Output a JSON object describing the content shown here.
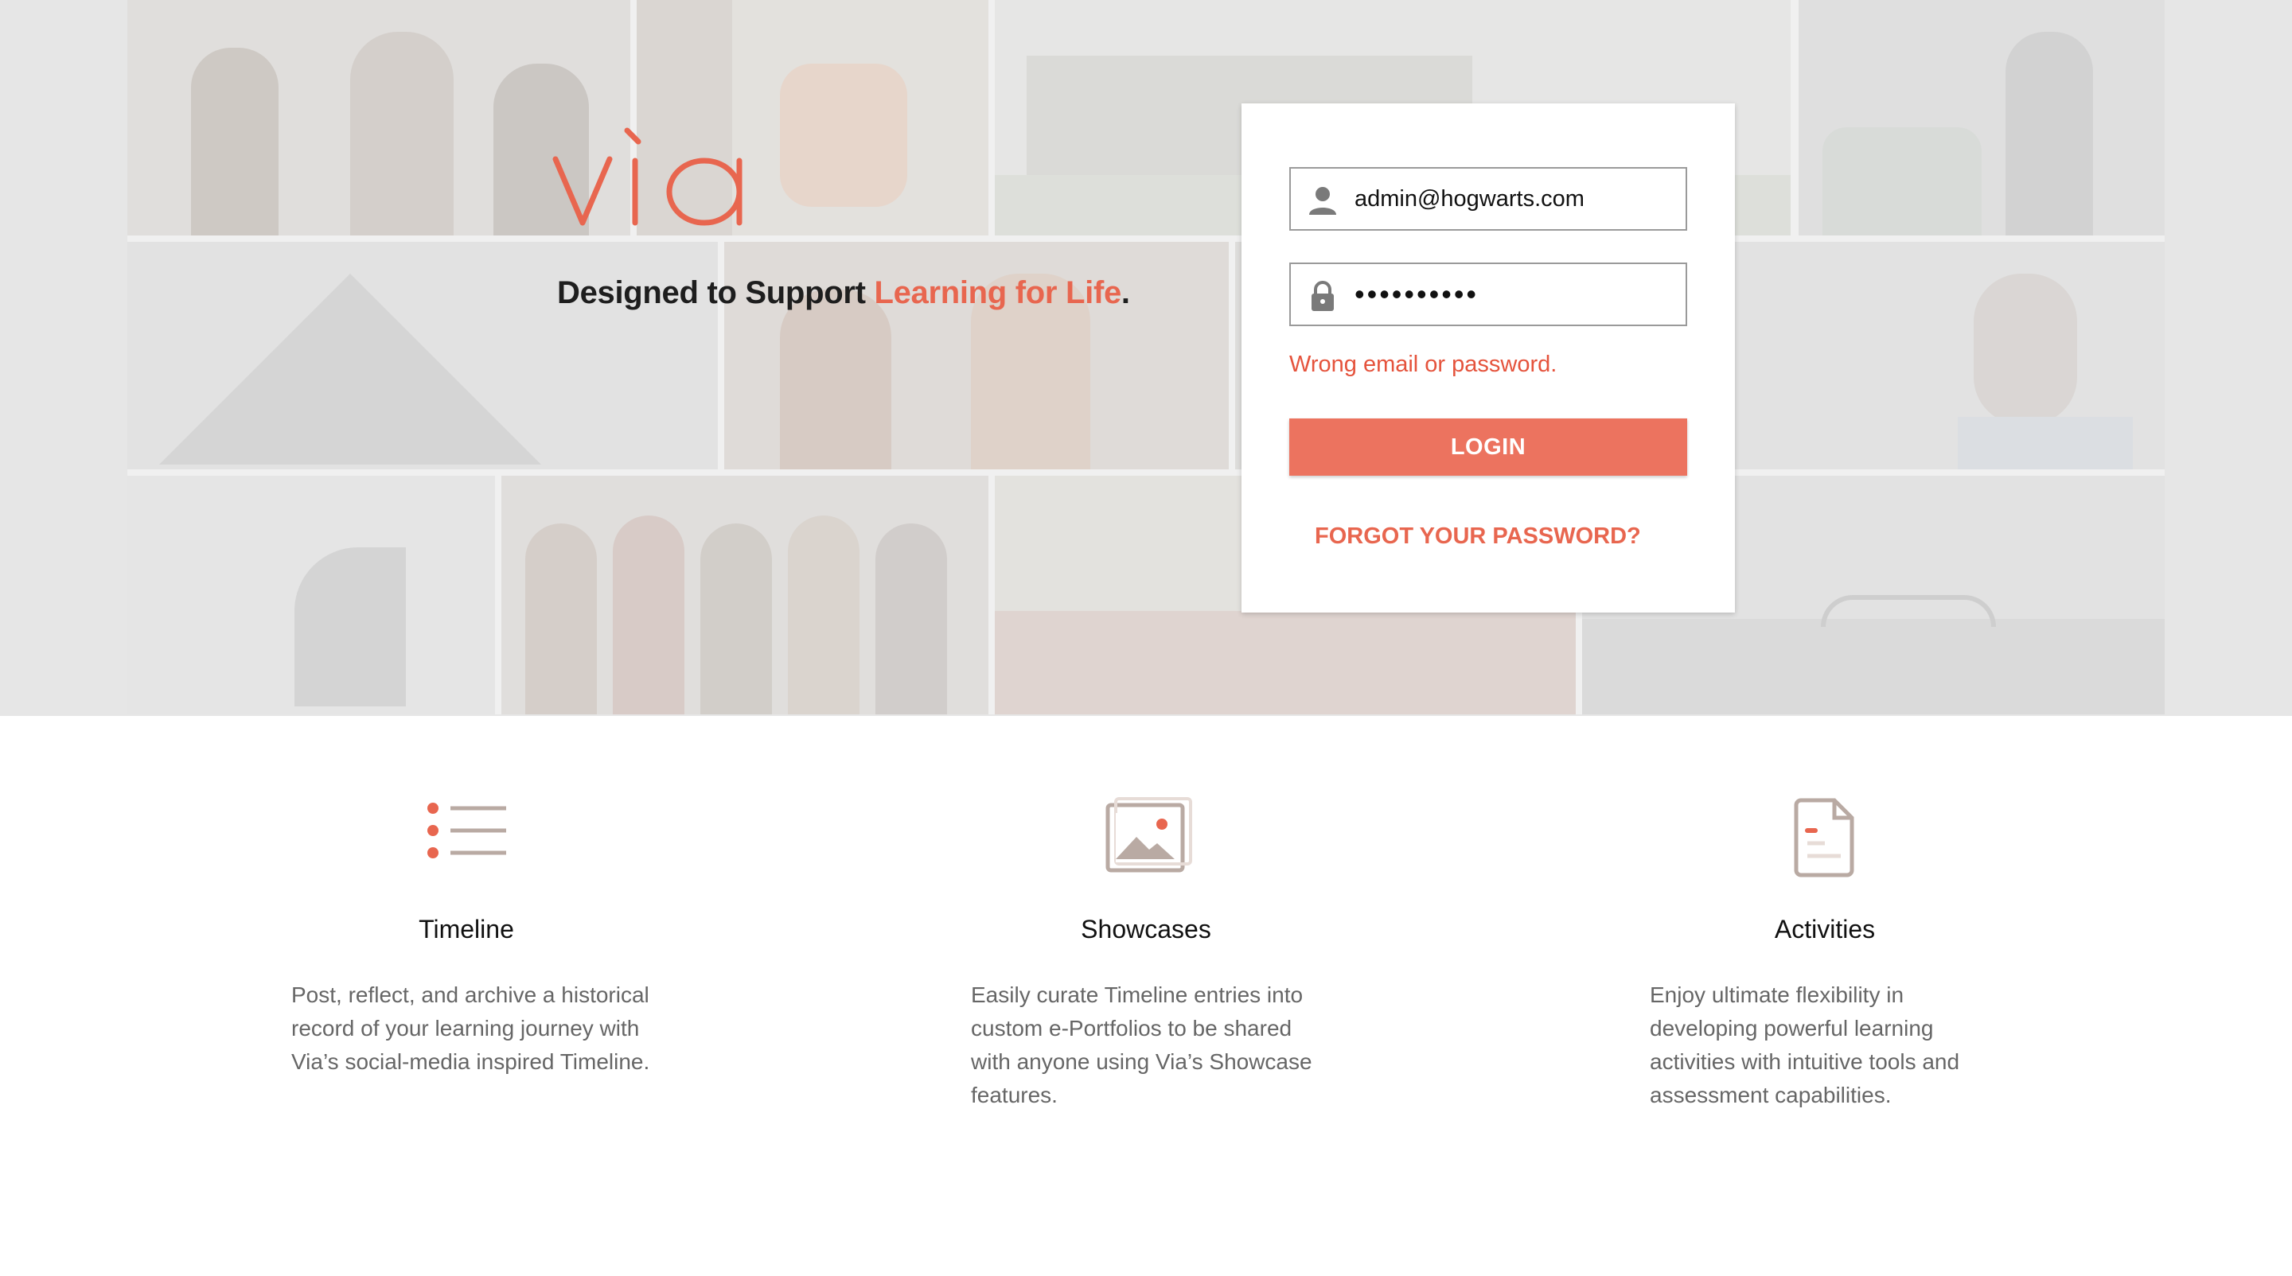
{
  "brand": {
    "logo_text": "via",
    "tagline_prefix": "Designed to Support ",
    "tagline_accent": "Learning for Life",
    "tagline_suffix": ".",
    "accent_color": "#e8664f"
  },
  "login": {
    "email_value": "admin@hogwarts.com",
    "email_icon": "user-icon",
    "password_value": "••••••••••",
    "password_icon": "lock-icon",
    "error_message": "Wrong email or password.",
    "login_label": "LOGIN",
    "forgot_label": "FORGOT YOUR PASSWORD?"
  },
  "features": [
    {
      "icon": "list-icon",
      "title": "Timeline",
      "lines": [
        "Post, reflect, and archive a historical",
        "record of your learning journey with",
        "Via’s social-media inspired Timeline."
      ]
    },
    {
      "icon": "image-icon",
      "title": "Showcases",
      "lines": [
        "Easily curate Timeline entries into",
        "custom e-Portfolios to be shared",
        "with anyone using Via’s Showcase",
        "features."
      ]
    },
    {
      "icon": "document-icon",
      "title": "Activities",
      "lines": [
        "Enjoy ultimate flexibility in",
        "developing powerful learning",
        "activities with intuitive tools and",
        "assessment capabilities."
      ]
    }
  ]
}
